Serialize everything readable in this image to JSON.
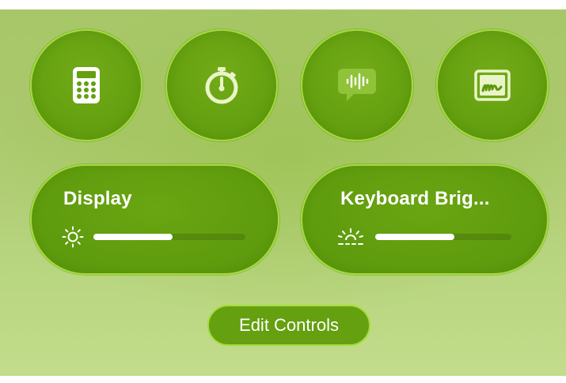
{
  "control_center": {
    "shortcuts": [
      {
        "name": "Calculator",
        "icon": "calculator-icon"
      },
      {
        "name": "Stopwatch",
        "icon": "stopwatch-icon"
      },
      {
        "name": "Voice Memos",
        "icon": "voice-memo-icon"
      },
      {
        "name": "Signature",
        "icon": "signature-icon"
      }
    ],
    "display": {
      "label": "Display",
      "icon": "brightness-sun-icon",
      "level": 0.52
    },
    "keyboard": {
      "label": "Keyboard Brig...",
      "icon": "keyboard-brightness-icon",
      "level": 0.58
    },
    "edit_button": {
      "label": "Edit Controls"
    },
    "colors": {
      "accent": "#64a010",
      "border": "#a3dc3a",
      "background": "#abc96d",
      "text": "#ffffff"
    }
  }
}
